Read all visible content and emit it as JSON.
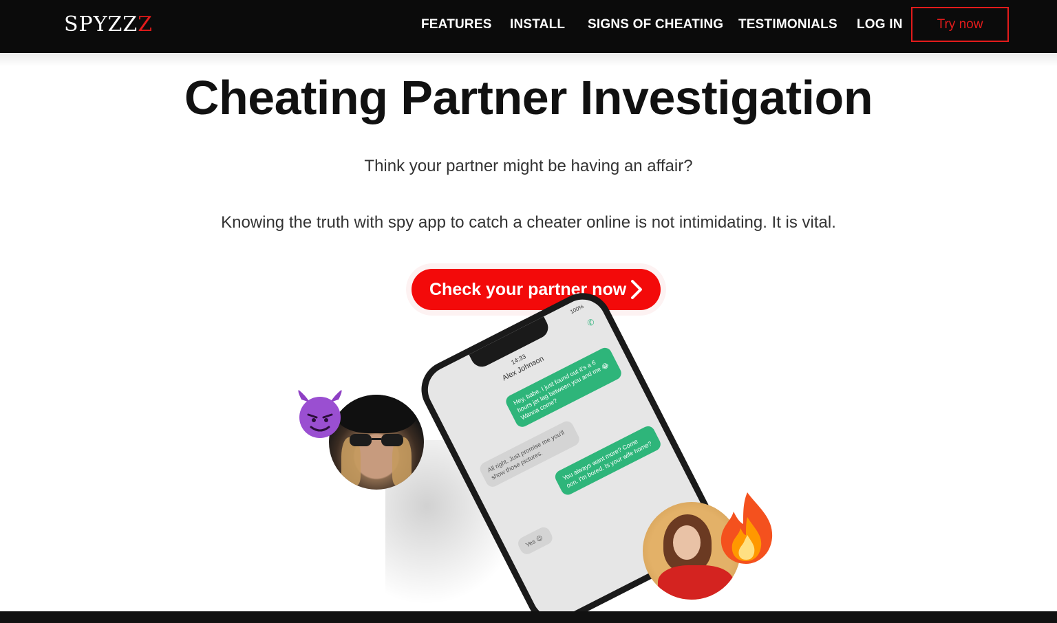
{
  "nav": {
    "logo_main": "SPYZZ",
    "logo_accent": "Z",
    "links": [
      "FEATURES",
      "INSTALL",
      "SIGNS OF CHEATING",
      "TESTIMONIALS",
      "LOG IN"
    ],
    "try_label": "Try now"
  },
  "hero": {
    "title": "Cheating Partner Investigation",
    "subtitle": "Think your partner might be having an affair?",
    "description": "Knowing the truth with spy app to catch a cheater online is not intimidating. It is vital.",
    "cta_label": "Check your partner now"
  },
  "phone": {
    "time": "14:33",
    "battery": "100%",
    "contact_name": "Alex Johnson",
    "messages": [
      {
        "direction": "out",
        "text": "Hey, babe. I just found out it's a 6 hours jet lag between you and me 😂 Wanna come?"
      },
      {
        "direction": "in",
        "text": "All right. Just promise me you'll show those pictures."
      },
      {
        "direction": "out",
        "text": "You always want more? Come oon. I'm bored. Is your wife home?"
      },
      {
        "direction": "in",
        "text": "Yes 😉"
      }
    ]
  },
  "colors": {
    "accent": "#e31b1b",
    "cta": "#f30a0a",
    "nav_bg": "#0b0b0b",
    "message_out": "#2eb57a"
  },
  "icons": [
    "chevron-right-icon",
    "devil-emoji-icon",
    "fire-emoji-icon",
    "phone-call-icon"
  ]
}
